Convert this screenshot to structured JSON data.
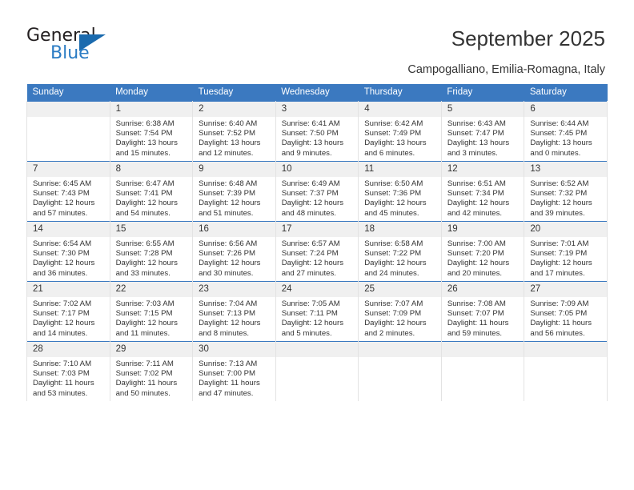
{
  "branding": {
    "name_top": "General",
    "name_bottom": "Blue",
    "accent_color": "#2b7cc4",
    "triangle_color": "#1a6aae"
  },
  "header": {
    "title": "September 2025",
    "subtitle": "Campogalliano, Emilia-Romagna, Italy"
  },
  "calendar": {
    "header_background": "#3b79c0",
    "daynum_background": "#f0f0f0",
    "weekday_headers": [
      "Sunday",
      "Monday",
      "Tuesday",
      "Wednesday",
      "Thursday",
      "Friday",
      "Saturday"
    ],
    "weeks": [
      [
        {
          "day": "",
          "sunrise": "",
          "sunset": "",
          "daylight_line1": "",
          "daylight_line2": ""
        },
        {
          "day": "1",
          "sunrise": "Sunrise: 6:38 AM",
          "sunset": "Sunset: 7:54 PM",
          "daylight_line1": "Daylight: 13 hours",
          "daylight_line2": "and 15 minutes."
        },
        {
          "day": "2",
          "sunrise": "Sunrise: 6:40 AM",
          "sunset": "Sunset: 7:52 PM",
          "daylight_line1": "Daylight: 13 hours",
          "daylight_line2": "and 12 minutes."
        },
        {
          "day": "3",
          "sunrise": "Sunrise: 6:41 AM",
          "sunset": "Sunset: 7:50 PM",
          "daylight_line1": "Daylight: 13 hours",
          "daylight_line2": "and 9 minutes."
        },
        {
          "day": "4",
          "sunrise": "Sunrise: 6:42 AM",
          "sunset": "Sunset: 7:49 PM",
          "daylight_line1": "Daylight: 13 hours",
          "daylight_line2": "and 6 minutes."
        },
        {
          "day": "5",
          "sunrise": "Sunrise: 6:43 AM",
          "sunset": "Sunset: 7:47 PM",
          "daylight_line1": "Daylight: 13 hours",
          "daylight_line2": "and 3 minutes."
        },
        {
          "day": "6",
          "sunrise": "Sunrise: 6:44 AM",
          "sunset": "Sunset: 7:45 PM",
          "daylight_line1": "Daylight: 13 hours",
          "daylight_line2": "and 0 minutes."
        }
      ],
      [
        {
          "day": "7",
          "sunrise": "Sunrise: 6:45 AM",
          "sunset": "Sunset: 7:43 PM",
          "daylight_line1": "Daylight: 12 hours",
          "daylight_line2": "and 57 minutes."
        },
        {
          "day": "8",
          "sunrise": "Sunrise: 6:47 AM",
          "sunset": "Sunset: 7:41 PM",
          "daylight_line1": "Daylight: 12 hours",
          "daylight_line2": "and 54 minutes."
        },
        {
          "day": "9",
          "sunrise": "Sunrise: 6:48 AM",
          "sunset": "Sunset: 7:39 PM",
          "daylight_line1": "Daylight: 12 hours",
          "daylight_line2": "and 51 minutes."
        },
        {
          "day": "10",
          "sunrise": "Sunrise: 6:49 AM",
          "sunset": "Sunset: 7:37 PM",
          "daylight_line1": "Daylight: 12 hours",
          "daylight_line2": "and 48 minutes."
        },
        {
          "day": "11",
          "sunrise": "Sunrise: 6:50 AM",
          "sunset": "Sunset: 7:36 PM",
          "daylight_line1": "Daylight: 12 hours",
          "daylight_line2": "and 45 minutes."
        },
        {
          "day": "12",
          "sunrise": "Sunrise: 6:51 AM",
          "sunset": "Sunset: 7:34 PM",
          "daylight_line1": "Daylight: 12 hours",
          "daylight_line2": "and 42 minutes."
        },
        {
          "day": "13",
          "sunrise": "Sunrise: 6:52 AM",
          "sunset": "Sunset: 7:32 PM",
          "daylight_line1": "Daylight: 12 hours",
          "daylight_line2": "and 39 minutes."
        }
      ],
      [
        {
          "day": "14",
          "sunrise": "Sunrise: 6:54 AM",
          "sunset": "Sunset: 7:30 PM",
          "daylight_line1": "Daylight: 12 hours",
          "daylight_line2": "and 36 minutes."
        },
        {
          "day": "15",
          "sunrise": "Sunrise: 6:55 AM",
          "sunset": "Sunset: 7:28 PM",
          "daylight_line1": "Daylight: 12 hours",
          "daylight_line2": "and 33 minutes."
        },
        {
          "day": "16",
          "sunrise": "Sunrise: 6:56 AM",
          "sunset": "Sunset: 7:26 PM",
          "daylight_line1": "Daylight: 12 hours",
          "daylight_line2": "and 30 minutes."
        },
        {
          "day": "17",
          "sunrise": "Sunrise: 6:57 AM",
          "sunset": "Sunset: 7:24 PM",
          "daylight_line1": "Daylight: 12 hours",
          "daylight_line2": "and 27 minutes."
        },
        {
          "day": "18",
          "sunrise": "Sunrise: 6:58 AM",
          "sunset": "Sunset: 7:22 PM",
          "daylight_line1": "Daylight: 12 hours",
          "daylight_line2": "and 24 minutes."
        },
        {
          "day": "19",
          "sunrise": "Sunrise: 7:00 AM",
          "sunset": "Sunset: 7:20 PM",
          "daylight_line1": "Daylight: 12 hours",
          "daylight_line2": "and 20 minutes."
        },
        {
          "day": "20",
          "sunrise": "Sunrise: 7:01 AM",
          "sunset": "Sunset: 7:19 PM",
          "daylight_line1": "Daylight: 12 hours",
          "daylight_line2": "and 17 minutes."
        }
      ],
      [
        {
          "day": "21",
          "sunrise": "Sunrise: 7:02 AM",
          "sunset": "Sunset: 7:17 PM",
          "daylight_line1": "Daylight: 12 hours",
          "daylight_line2": "and 14 minutes."
        },
        {
          "day": "22",
          "sunrise": "Sunrise: 7:03 AM",
          "sunset": "Sunset: 7:15 PM",
          "daylight_line1": "Daylight: 12 hours",
          "daylight_line2": "and 11 minutes."
        },
        {
          "day": "23",
          "sunrise": "Sunrise: 7:04 AM",
          "sunset": "Sunset: 7:13 PM",
          "daylight_line1": "Daylight: 12 hours",
          "daylight_line2": "and 8 minutes."
        },
        {
          "day": "24",
          "sunrise": "Sunrise: 7:05 AM",
          "sunset": "Sunset: 7:11 PM",
          "daylight_line1": "Daylight: 12 hours",
          "daylight_line2": "and 5 minutes."
        },
        {
          "day": "25",
          "sunrise": "Sunrise: 7:07 AM",
          "sunset": "Sunset: 7:09 PM",
          "daylight_line1": "Daylight: 12 hours",
          "daylight_line2": "and 2 minutes."
        },
        {
          "day": "26",
          "sunrise": "Sunrise: 7:08 AM",
          "sunset": "Sunset: 7:07 PM",
          "daylight_line1": "Daylight: 11 hours",
          "daylight_line2": "and 59 minutes."
        },
        {
          "day": "27",
          "sunrise": "Sunrise: 7:09 AM",
          "sunset": "Sunset: 7:05 PM",
          "daylight_line1": "Daylight: 11 hours",
          "daylight_line2": "and 56 minutes."
        }
      ],
      [
        {
          "day": "28",
          "sunrise": "Sunrise: 7:10 AM",
          "sunset": "Sunset: 7:03 PM",
          "daylight_line1": "Daylight: 11 hours",
          "daylight_line2": "and 53 minutes."
        },
        {
          "day": "29",
          "sunrise": "Sunrise: 7:11 AM",
          "sunset": "Sunset: 7:02 PM",
          "daylight_line1": "Daylight: 11 hours",
          "daylight_line2": "and 50 minutes."
        },
        {
          "day": "30",
          "sunrise": "Sunrise: 7:13 AM",
          "sunset": "Sunset: 7:00 PM",
          "daylight_line1": "Daylight: 11 hours",
          "daylight_line2": "and 47 minutes."
        },
        {
          "day": "",
          "sunrise": "",
          "sunset": "",
          "daylight_line1": "",
          "daylight_line2": ""
        },
        {
          "day": "",
          "sunrise": "",
          "sunset": "",
          "daylight_line1": "",
          "daylight_line2": ""
        },
        {
          "day": "",
          "sunrise": "",
          "sunset": "",
          "daylight_line1": "",
          "daylight_line2": ""
        },
        {
          "day": "",
          "sunrise": "",
          "sunset": "",
          "daylight_line1": "",
          "daylight_line2": ""
        }
      ]
    ]
  }
}
